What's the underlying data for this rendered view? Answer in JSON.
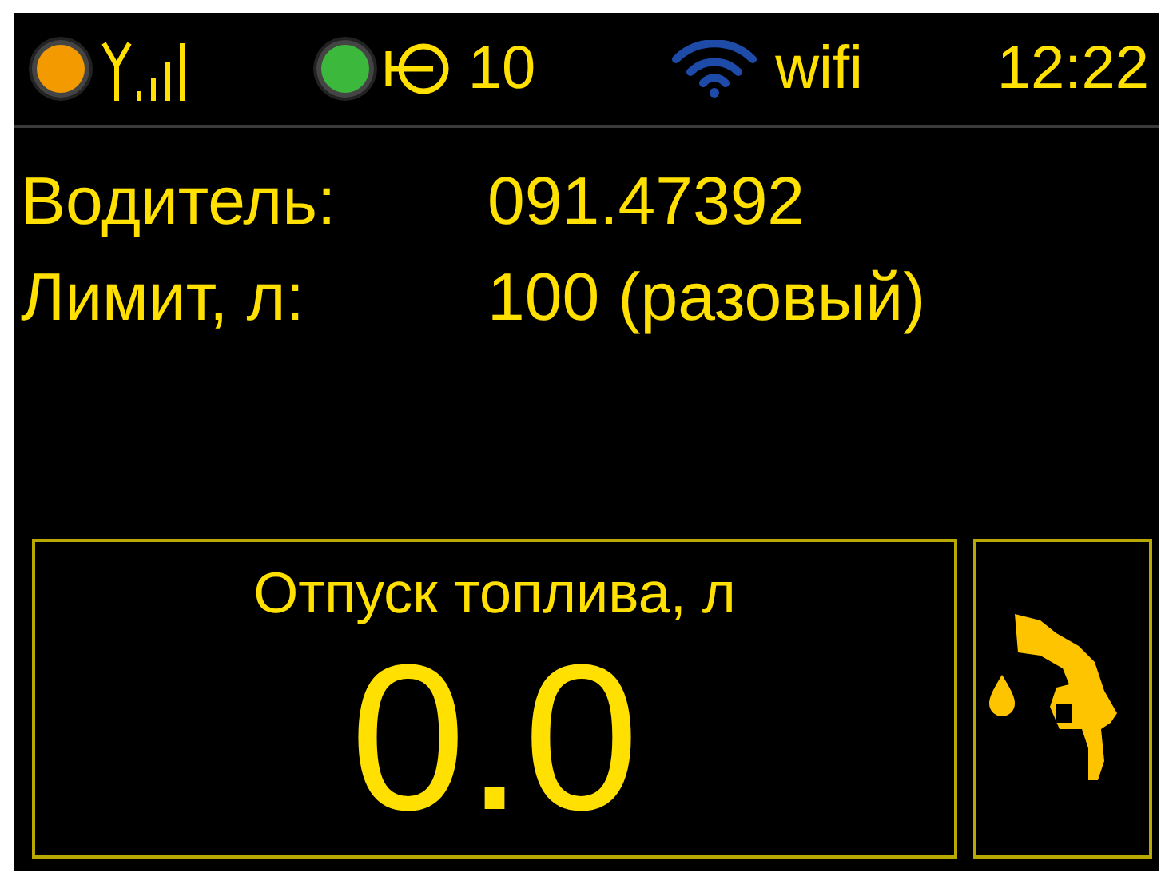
{
  "status_bar": {
    "indicators": [
      {
        "kind": "signal",
        "color": "#f29a00"
      },
      {
        "kind": "network",
        "color": "#3cb83c",
        "text": "10"
      }
    ],
    "wifi": "wifi",
    "time": "12:22"
  },
  "info": [
    {
      "label": "Водитель:",
      "value": "091.47392"
    },
    {
      "label": "Лимит, л:",
      "value": "100 (разовый)"
    }
  ],
  "dispense": {
    "title": "Отпуск топлива, л",
    "value": "0.0"
  }
}
